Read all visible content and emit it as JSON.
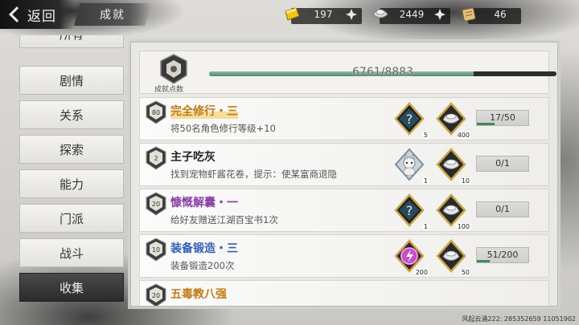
{
  "header": {
    "back_label": "返回",
    "title": "成就"
  },
  "currencies": [
    {
      "icon": "gold-ingot-icon",
      "value": "197",
      "color": "#e6b800"
    },
    {
      "icon": "silver-ingot-icon",
      "value": "2449",
      "color": "#cfd3d6"
    },
    {
      "icon": "scroll-icon",
      "value": "46",
      "color": "#d8b36a"
    }
  ],
  "sidebar": {
    "items": [
      {
        "label": "所有"
      },
      {
        "label": "剧情"
      },
      {
        "label": "关系"
      },
      {
        "label": "探索"
      },
      {
        "label": "能力"
      },
      {
        "label": "门派"
      },
      {
        "label": "战斗"
      },
      {
        "label": "收集",
        "active": true
      }
    ]
  },
  "points": {
    "label": "成就点数",
    "current": 6761,
    "total": 8883,
    "text": "6761/8883"
  },
  "achievements": [
    {
      "badge": "80",
      "name": "完全修行・三",
      "name_color": "orange",
      "description": "将50名角色修行等级+10",
      "rewards": [
        {
          "icon": "mystery-box-icon",
          "count": "5"
        },
        {
          "icon": "silver-ingot-icon",
          "count": "400"
        }
      ],
      "progress": "17/50",
      "progress_fraction": 0.34
    },
    {
      "badge": "2",
      "name": "主子吃灰",
      "name_color": "plain",
      "description": "找到宠物虾酱花卷，提示：使某富商退隐",
      "rewards": [
        {
          "icon": "cat-pet-icon",
          "count": "1"
        },
        {
          "icon": "silver-ingot-icon",
          "count": "10"
        }
      ],
      "progress": "0/1",
      "progress_fraction": 0
    },
    {
      "badge": "20",
      "name": "慷慨解囊・一",
      "name_color": "purple",
      "description": "给好友赠送江湖百宝书1次",
      "rewards": [
        {
          "icon": "mystery-box-icon",
          "count": "1"
        },
        {
          "icon": "silver-ingot-icon",
          "count": "100"
        }
      ],
      "progress": "0/1",
      "progress_fraction": 0
    },
    {
      "badge": "10",
      "name": "装备锻造・三",
      "name_color": "blue",
      "description": "装备锻造200次",
      "rewards": [
        {
          "icon": "forge-stone-icon",
          "count": "200"
        },
        {
          "icon": "silver-ingot-icon",
          "count": "50"
        }
      ],
      "progress": "51/200",
      "progress_fraction": 0.255
    },
    {
      "badge": "20",
      "name": "五毒教八强",
      "name_color": "orange",
      "description": "",
      "rewards": [],
      "progress": "",
      "progress_fraction": 0
    }
  ],
  "watermark": "风起云涌222: 285352659  11051902"
}
